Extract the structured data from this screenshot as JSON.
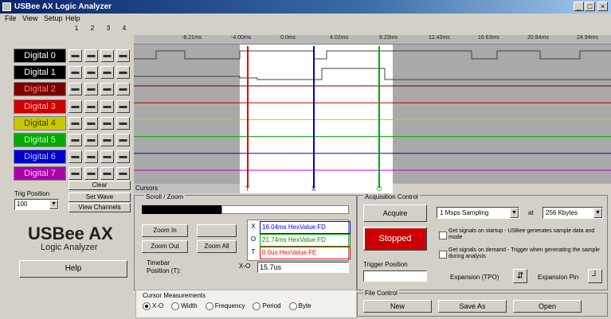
{
  "window": {
    "title": "USBee AX Logic Analyzer"
  },
  "menu": [
    "File",
    "View",
    "Setup",
    "Help"
  ],
  "column_headers": [
    "1",
    "2",
    "3",
    "4"
  ],
  "signals": [
    {
      "label": "Digital 0",
      "bg": "#000000",
      "fg": "#ffffff",
      "swatch": "#000000"
    },
    {
      "label": "Digital 1",
      "bg": "#000000",
      "fg": "#ffffff",
      "swatch": "#000000"
    },
    {
      "label": "Digital 2",
      "bg": "#7a0000",
      "fg": "#ff8080",
      "swatch": "#7a0000"
    },
    {
      "label": "Digital 3",
      "bg": "#cc0000",
      "fg": "#ffb0b0",
      "swatch": "#cc0000"
    },
    {
      "label": "Digital 4",
      "bg": "#c8c800",
      "fg": "#404000",
      "swatch": "#8a8a00"
    },
    {
      "label": "Digital 5",
      "bg": "#00aa00",
      "fg": "#c0ffc0",
      "swatch": "#00aa00"
    },
    {
      "label": "Digital 6",
      "bg": "#0000cc",
      "fg": "#c0c0ff",
      "swatch": "#0000cc"
    },
    {
      "label": "Digital 7",
      "bg": "#aa00aa",
      "fg": "#ffc0ff",
      "swatch": "#7a007a"
    }
  ],
  "signal_buttons": {
    "clear": "Clear",
    "set_wave": "Set Wave",
    "view_channels": "View Channels"
  },
  "time_ticks": [
    "-8.21ms",
    "-4.00ms",
    "0.0ms",
    "4.02ms",
    "8.23ms",
    "12.43ms",
    "16.63ms",
    "20.84ms",
    "24.94ms"
  ],
  "trigger_edge_label": "Trig Position",
  "sample_rate_select": "100",
  "brand": {
    "name": "USBee AX",
    "subtitle": "Logic Analyzer"
  },
  "help_button": "Help",
  "zoom": {
    "group_label": "Scroll / Zoom",
    "zoom_in": "Zoom In",
    "zoom_out": "Zoom Out",
    "zoom_all": "Zoom All"
  },
  "timebar": {
    "label": "Timebar",
    "value": "Position (T):"
  },
  "cursors": {
    "x": {
      "tag": "X",
      "text": "16.04ms HexValue:FD",
      "color": "#0000ff"
    },
    "o": {
      "tag": "O",
      "text": "21.74ms HexValue:FD",
      "color": "#00aa00"
    },
    "t": {
      "tag": "T",
      "text": "0.0us HexValue:FE",
      "color": "#ff0000"
    }
  },
  "delta": {
    "label": "X-O",
    "value": "15.7us"
  },
  "cursor_measurements": {
    "title": "Cursor Measurements",
    "options": [
      "X-O",
      "Width",
      "Frequency",
      "Period",
      "Byte"
    ],
    "selected": "X-O"
  },
  "acquisition": {
    "group": "Acquisition Control",
    "acquire": "Acquire",
    "status": "Stopped",
    "rate": "1 Msps Sampling",
    "at_label": "at",
    "buffer": "256 Kbytes",
    "trigger_position_label": "Trigger Position",
    "check1": "Get signals on startup - USBee generates sample data and mode",
    "check2": "Get signals on demand - Trigger when generating the sample during analysis",
    "expansion_label": "Expansion (TPO)",
    "expansion_value": "Expansion Pin"
  },
  "file_control": {
    "group": "File Control",
    "new": "New",
    "save_as": "Save As",
    "open": "Open"
  },
  "markers": {
    "t": "T",
    "x": "X",
    "o": "O"
  },
  "wave_label": "Cursors"
}
